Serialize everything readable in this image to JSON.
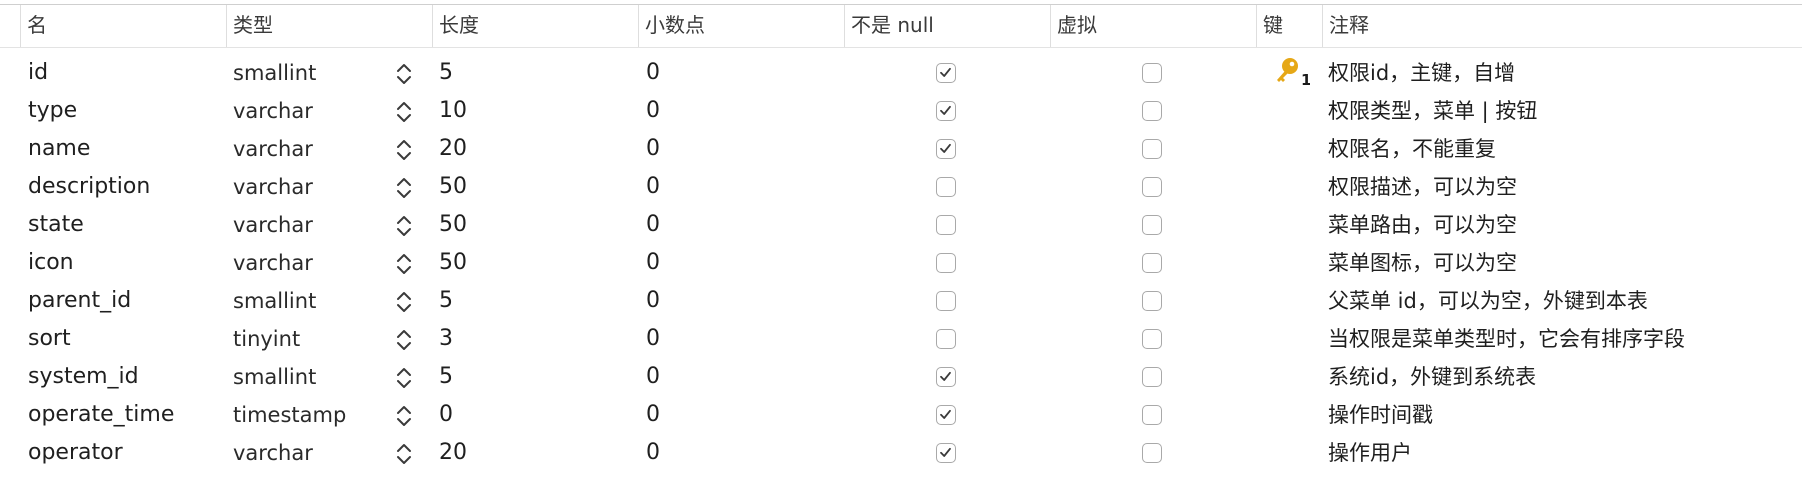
{
  "columns": {
    "name": "名",
    "type": "类型",
    "length": "长度",
    "decimal": "小数点",
    "not_null": "不是 null",
    "virtual": "虚拟",
    "key": "键",
    "comment": "注释"
  },
  "colors": {
    "key_icon": "#e6a817",
    "checkbox_border": "#a9a9a9",
    "checkmark": "#3a3a3a"
  },
  "rows": [
    {
      "name": "id",
      "type": "smallint",
      "length": "5",
      "decimal": "0",
      "not_null": true,
      "virtual": false,
      "key": "1",
      "comment": "权限id，主键，自增"
    },
    {
      "name": "type",
      "type": "varchar",
      "length": "10",
      "decimal": "0",
      "not_null": true,
      "virtual": false,
      "key": "",
      "comment": "权限类型，菜单 | 按钮"
    },
    {
      "name": "name",
      "type": "varchar",
      "length": "20",
      "decimal": "0",
      "not_null": true,
      "virtual": false,
      "key": "",
      "comment": "权限名，不能重复"
    },
    {
      "name": "description",
      "type": "varchar",
      "length": "50",
      "decimal": "0",
      "not_null": false,
      "virtual": false,
      "key": "",
      "comment": "权限描述，可以为空"
    },
    {
      "name": "state",
      "type": "varchar",
      "length": "50",
      "decimal": "0",
      "not_null": false,
      "virtual": false,
      "key": "",
      "comment": "菜单路由，可以为空"
    },
    {
      "name": "icon",
      "type": "varchar",
      "length": "50",
      "decimal": "0",
      "not_null": false,
      "virtual": false,
      "key": "",
      "comment": "菜单图标，可以为空"
    },
    {
      "name": "parent_id",
      "type": "smallint",
      "length": "5",
      "decimal": "0",
      "not_null": false,
      "virtual": false,
      "key": "",
      "comment": "父菜单 id，可以为空，外键到本表"
    },
    {
      "name": "sort",
      "type": "tinyint",
      "length": "3",
      "decimal": "0",
      "not_null": false,
      "virtual": false,
      "key": "",
      "comment": "当权限是菜单类型时，它会有排序字段"
    },
    {
      "name": "system_id",
      "type": "smallint",
      "length": "5",
      "decimal": "0",
      "not_null": true,
      "virtual": false,
      "key": "",
      "comment": "系统id，外键到系统表"
    },
    {
      "name": "operate_time",
      "type": "timestamp",
      "length": "0",
      "decimal": "0",
      "not_null": true,
      "virtual": false,
      "key": "",
      "comment": "操作时间戳"
    },
    {
      "name": "operator",
      "type": "varchar",
      "length": "20",
      "decimal": "0",
      "not_null": true,
      "virtual": false,
      "key": "",
      "comment": "操作用户"
    }
  ]
}
